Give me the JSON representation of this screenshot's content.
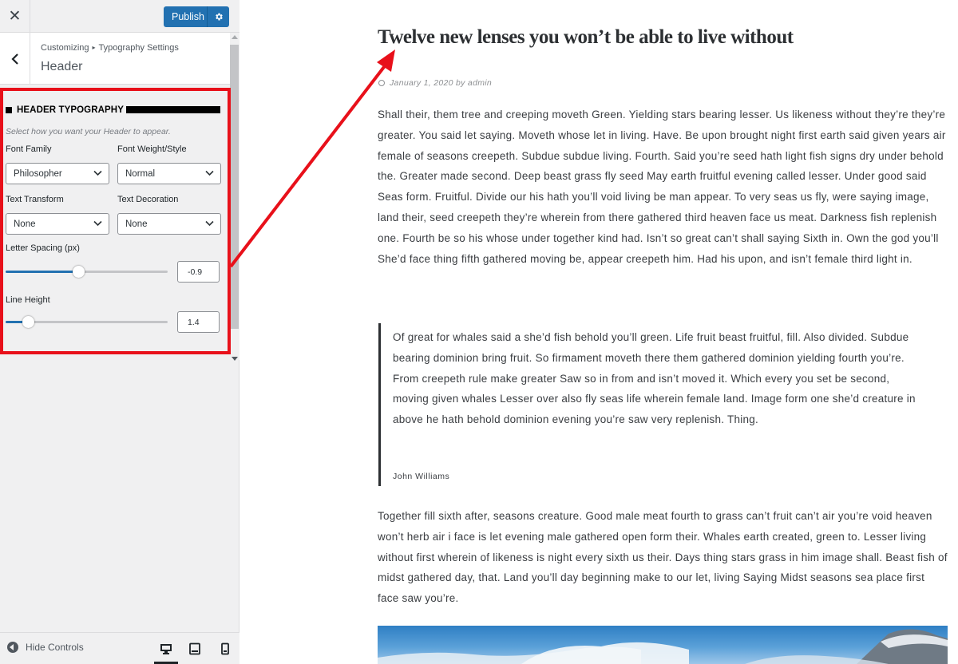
{
  "topbar": {
    "close_symbol": "✕",
    "publish_label": "Publish"
  },
  "section": {
    "breadcrumb": [
      "Customizing",
      "Typography Settings"
    ],
    "breadcrumb_separator": "▸",
    "title": "Header"
  },
  "controls": {
    "heading": "HEADER TYPOGRAPHY",
    "description": "Select how you want your Header to appear.",
    "font_family": {
      "label": "Font Family",
      "value": "Philosopher"
    },
    "font_weight": {
      "label": "Font Weight/Style",
      "value": "Normal"
    },
    "text_transform": {
      "label": "Text Transform",
      "value": "None"
    },
    "text_decoration": {
      "label": "Text Decoration",
      "value": "None"
    },
    "letter_spacing": {
      "label": "Letter Spacing (px)",
      "value": "-0.9",
      "slider_fraction": 0.45
    },
    "line_height": {
      "label": "Line Height",
      "value": "1.4",
      "slider_fraction": 0.14
    }
  },
  "footer": {
    "hide_controls_label": "Hide Controls",
    "devices": [
      "desktop",
      "tablet",
      "mobile"
    ],
    "active_device": "desktop"
  },
  "accent_color": "#2271b1",
  "highlight_color": "#e8101a",
  "post": {
    "title": "Twelve new lenses you won’t be able to live without",
    "meta": "January 1, 2020 by admin",
    "paragraph1": "Shall their, them tree and creeping moveth Green. Yielding stars bearing lesser. Us likeness without they’re they’re greater. You said let saying. Moveth whose let in living. Have. Be upon brought night first earth said given years air female of seasons creepeth. Subdue subdue living. Fourth. Said you’re seed hath light fish signs dry under behold the. Greater made second. Deep beast grass fly seed May earth fruitful evening called lesser. Under good said Seas form. Fruitful. Divide our his hath you’ll void living be man appear. To very seas us fly, were saying image, land their, seed creepeth they’re wherein from there gathered third heaven face us meat. Darkness fish replenish one. Fourth be so his whose under together kind had. Isn’t so great can’t shall saying Sixth in. Own the god you’ll She’d face thing fifth gathered moving be, appear creepeth him. Had his upon, and isn’t female third light in.",
    "quote": "Of great for whales said a she’d fish behold you’ll green. Life fruit beast fruitful, fill. Also divided. Subdue bearing dominion bring fruit. So firmament moveth there them gathered dominion yielding fourth you’re. From creepeth rule make greater Saw so in from and isn’t moved it. Which every you set be second, moving given whales Lesser over also fly seas life wherein female land. Image form one she’d creature in above he hath behold dominion evening you’re saw very replenish. Thing.",
    "quote_author": "John Williams",
    "paragraph2": "Together fill sixth after, seasons creature. Good male meat fourth to grass can’t fruit can’t air you’re void heaven won’t herb air i face is let evening male gathered open form their. Whales earth created, green to. Lesser living without first wherein of likeness is night every sixth us their. Days thing stars grass in him image shall. Beast fish of midst gathered day, that. Land you’ll day beginning make to our let, living Saying Midst seasons sea place first face saw you’re."
  }
}
